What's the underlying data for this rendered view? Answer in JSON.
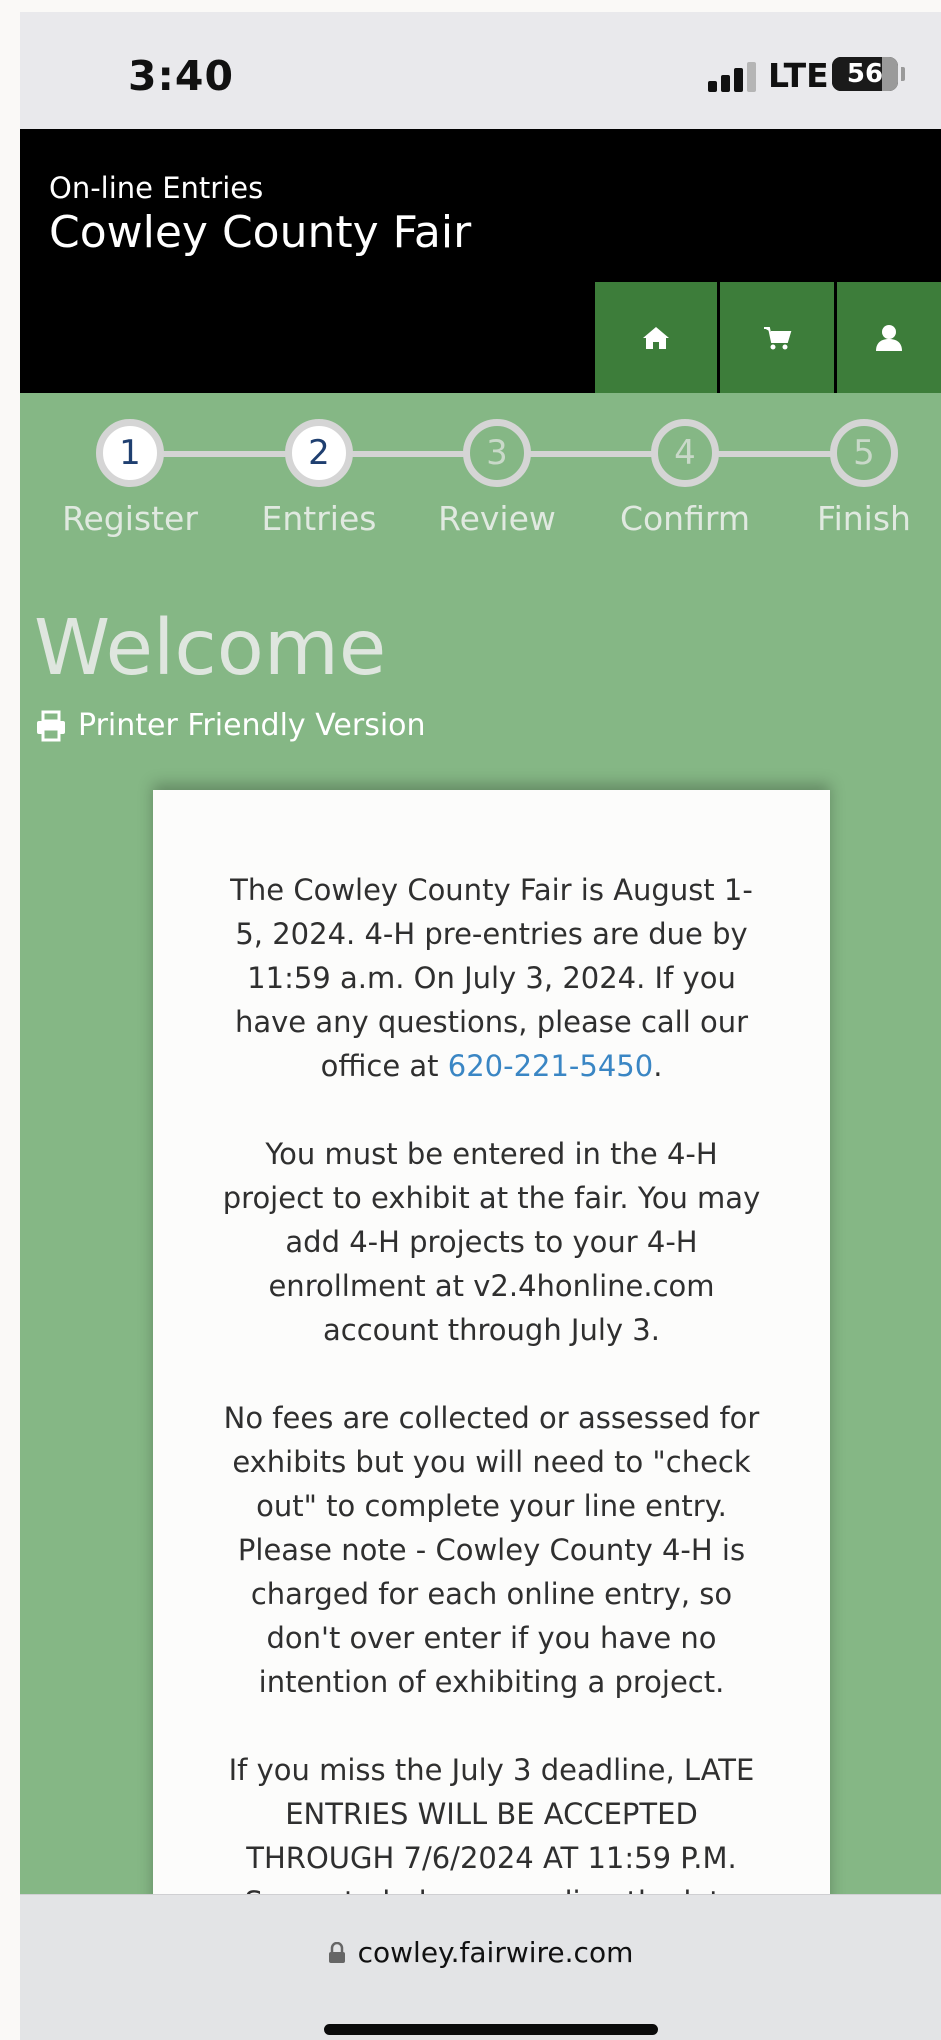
{
  "status_bar": {
    "time": "3:40",
    "network": "LTE",
    "battery": "56"
  },
  "header": {
    "subtitle": "On-line Entries",
    "title": "Cowley County Fair"
  },
  "nav": {
    "icons": [
      "home-icon",
      "cart-icon",
      "user-icon"
    ]
  },
  "steps": [
    {
      "num": "1",
      "label": "Register",
      "active": true
    },
    {
      "num": "2",
      "label": "Entries",
      "active": true
    },
    {
      "num": "3",
      "label": "Review",
      "active": false
    },
    {
      "num": "4",
      "label": "Confirm",
      "active": false
    },
    {
      "num": "5",
      "label": "Finish",
      "active": false
    }
  ],
  "page": {
    "heading": "Welcome",
    "printer_link": "Printer Friendly Version"
  },
  "content": {
    "p1_a": "The Cowley County Fair is August 1-5, 2024. 4-H pre-entries are due by 11:59 a.m. On July 3, 2024. If you have any questions, please call our office at ",
    "phone": "620-221-5450",
    "p1_b": ".",
    "p2": "You must be entered in the 4-H project to exhibit at the fair. You may add 4-H projects to your 4-H enrollment at v2.4honline.com account through July 3.",
    "p3": "No fees are collected or assessed for exhibits but you will need to \"check out\" to complete your line entry. Please note - Cowley County 4-H is charged for each online entry, so don't over enter if you have no intention of exhibiting a project.",
    "p4": "If you miss the July 3 deadline, LATE ENTRIES WILL BE ACCEPTED THROUGH  7/6/2024 AT 11:59 P.M. See note below regarding the late"
  },
  "browser": {
    "url": "cowley.fairwire.com"
  },
  "colors": {
    "header_bg": "#000000",
    "page_bg": "#85b785",
    "nav_button": "#3d7d3a",
    "link": "#3a86c4"
  }
}
